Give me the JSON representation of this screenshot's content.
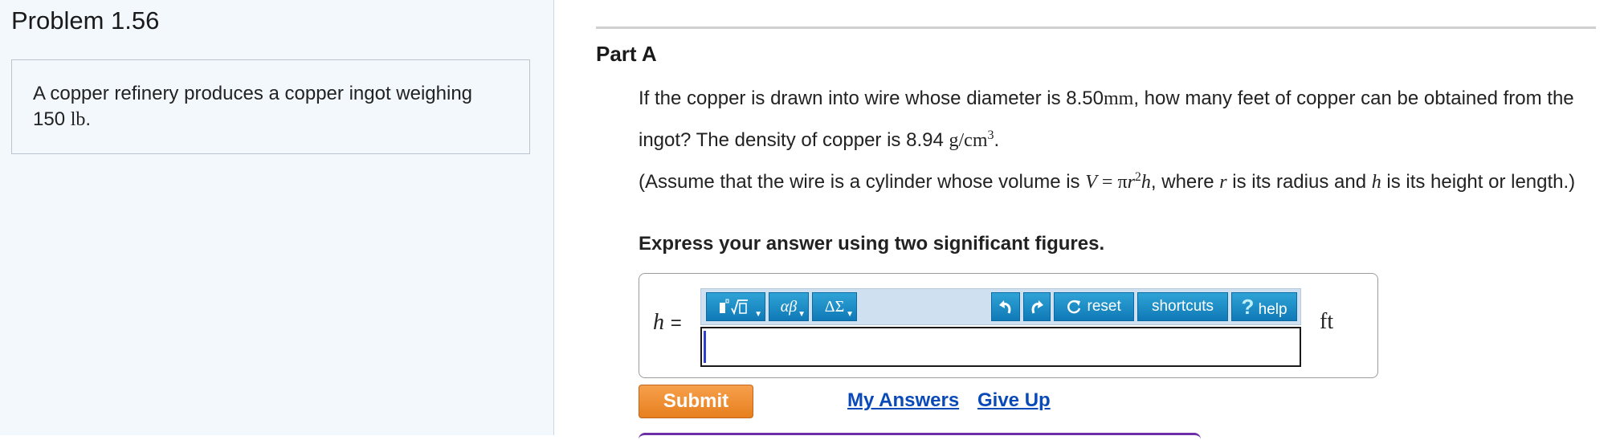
{
  "problem": {
    "title": "Problem 1.56",
    "intro_text": "A copper refinery produces a copper ingot weighing 150",
    "intro_unit": "lb",
    "intro_end": "."
  },
  "part": {
    "title": "Part A",
    "q1": "If the copper is drawn into wire whose diameter is",
    "diameter_value": "8.50",
    "diameter_unit": "mm",
    "q2": ", how many feet of copper can be obtained from the ingot? The density of copper is",
    "density_value": "8.94",
    "density_unit": "g/cm",
    "density_exp": "3",
    "q3": ".",
    "assume1": "(Assume that the wire is a cylinder whose volume is",
    "formula_V": "V",
    "formula_eq": " = π",
    "formula_r": "r",
    "formula_exp": "2",
    "formula_h": "h",
    "assume2": ", where",
    "assume_r": "r",
    "assume3": "is its radius and",
    "assume_h": "h",
    "assume4": "is its height or length.)",
    "instructions": "Express your answer using two significant figures."
  },
  "answer": {
    "variable": "h",
    "equals": "=",
    "unit": "ft",
    "value": "",
    "toolbar": {
      "templates_icon": "templates-icon",
      "greek_label": "αβ",
      "symbols_label": "ΔΣ",
      "undo_icon": "undo-icon",
      "redo_icon": "redo-icon",
      "reset_label": "reset",
      "shortcuts_label": "shortcuts",
      "help_label": "help"
    }
  },
  "actions": {
    "submit_label": "Submit",
    "my_answers_label": "My Answers",
    "give_up_label": "Give Up"
  },
  "colors": {
    "toolbar_button": "#1a8cc6",
    "submit": "#ef8c2f",
    "link": "#0a49b8",
    "left_panel_bg": "#f3f8fd"
  }
}
